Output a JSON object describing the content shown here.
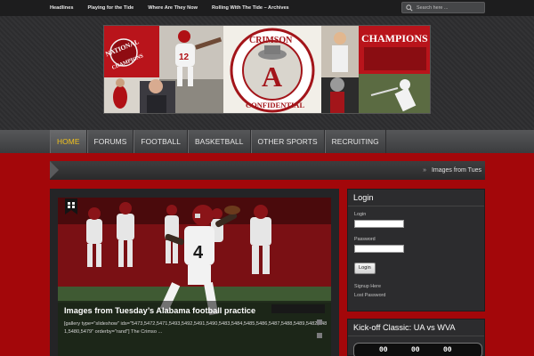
{
  "topnav": {
    "links": [
      "Headlines",
      "Playing for the Tide",
      "Where Are They Now",
      "Rolling With The Tide – Archives"
    ],
    "search_placeholder": "Search here ..."
  },
  "banner": {
    "left_text": "NATIONAL CHAMPIONS",
    "logo_top": "CRIMSON",
    "logo_letter": "A",
    "logo_bottom": "CONFIDENTIAL",
    "right_text": "CHAMPIONS",
    "jersey_number": "12"
  },
  "mainnav": {
    "items": [
      "HOME",
      "FORUMS",
      "FOOTBALL",
      "BASKETBALL",
      "OTHER SPORTS",
      "RECRUITING"
    ],
    "active": "HOME"
  },
  "breadcrumb": {
    "separator": "»",
    "current": "Images from Tues"
  },
  "featured": {
    "title": "Images from Tuesday’s Alabama football practice",
    "excerpt": "[gallery type=\"slideshow\" ids=\"5473,5472,5471,5493,5492,5491,5490,5483,5484,5485,5486,5487,5488,5489,5482,5481,5480,5479\" orderby=\"rand\"]    The Crimso ...",
    "jersey_number": "4"
  },
  "login": {
    "title": "Login",
    "username_label": "Login",
    "password_label": "Password",
    "button_label": "Login",
    "signup_link": "Signup Here",
    "lost_link": "Lost Password"
  },
  "kickoff": {
    "title": "Kick-off Classic: UA vs WVA",
    "countdown": [
      "00",
      "00",
      "00"
    ]
  },
  "colors": {
    "page_red": "#a3070a",
    "active_nav": "#f2c21c"
  }
}
